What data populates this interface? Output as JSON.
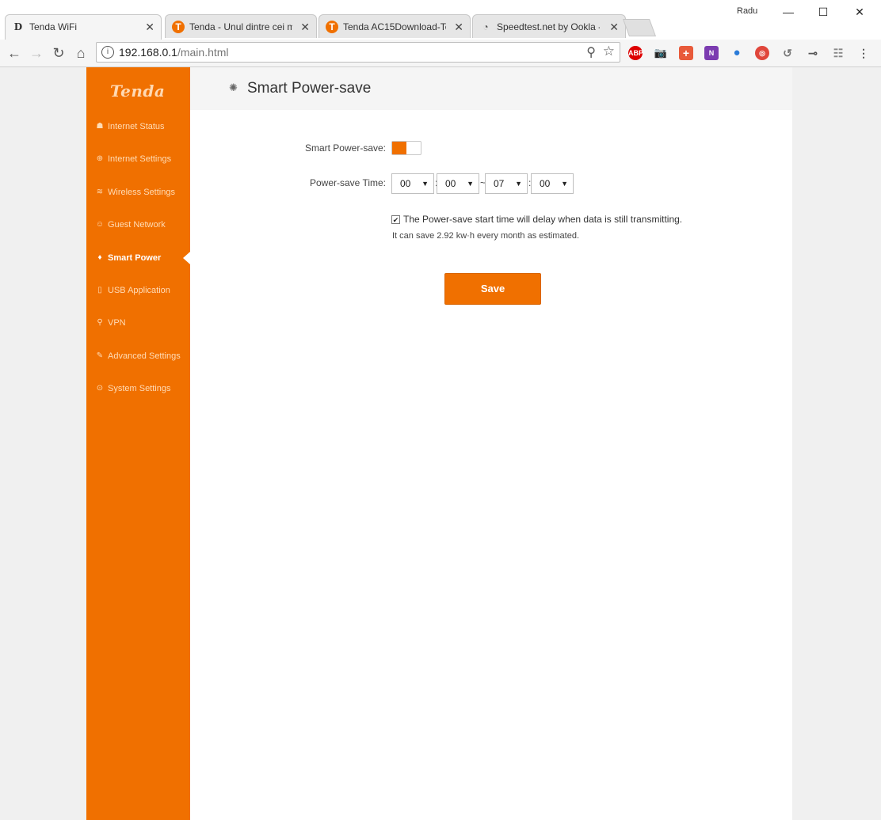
{
  "browser": {
    "user_name": "Radu",
    "tabs": [
      {
        "label": "Tenda WiFi",
        "icon": "D"
      },
      {
        "label": "Tenda - Unul dintre cei m",
        "icon": "T"
      },
      {
        "label": "Tenda AC15Download-Te",
        "icon": "T"
      },
      {
        "label": "Speedtest.net by Ookla -",
        "icon": "◔"
      }
    ],
    "url_host": "192.168.0.1",
    "url_path": "/main.html",
    "extensions": [
      "ABP",
      "📷",
      "+",
      "N",
      "●",
      "◎",
      "↺",
      "⊸",
      "☷",
      "⋮"
    ]
  },
  "sidebar": {
    "logo": "Tenda",
    "items": [
      {
        "label": "Internet Status",
        "icon": "☗"
      },
      {
        "label": "Internet Settings",
        "icon": "⊕"
      },
      {
        "label": "Wireless Settings",
        "icon": "≋"
      },
      {
        "label": "Guest Network",
        "icon": "☺"
      },
      {
        "label": "Smart Power",
        "icon": "♦"
      },
      {
        "label": "USB Application",
        "icon": "▯"
      },
      {
        "label": "VPN",
        "icon": "⚲"
      },
      {
        "label": "Advanced Settings",
        "icon": "✎"
      },
      {
        "label": "System Settings",
        "icon": "⊙"
      }
    ],
    "active_index": 4
  },
  "main": {
    "title": "Smart Power-save",
    "smart_power_label": "Smart Power-save:",
    "smart_power_enabled": true,
    "time_label": "Power-save Time:",
    "start_hour": "00",
    "start_minute": "00",
    "end_hour": "07",
    "end_minute": "00",
    "colon": ":",
    "tilde": "~",
    "delay_text": "The Power-save start time will delay when data is still transmitting.",
    "delay_checked": true,
    "estimate_text": "It can save 2.92 kw·h every month as estimated.",
    "save_label": "Save"
  },
  "colors": {
    "accent": "#f07000"
  }
}
